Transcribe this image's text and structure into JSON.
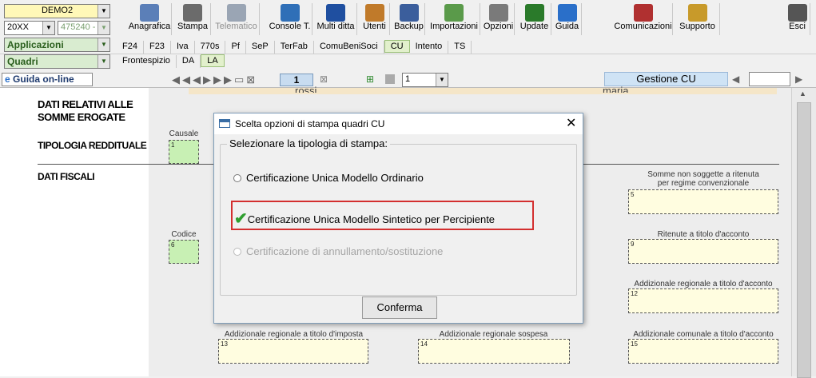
{
  "toolbar": {
    "company_combo": "DEMO2",
    "year_combo": "20XX",
    "code_combo": "475240 -",
    "applicazioni_combo": "Applicazioni",
    "quadri_combo": "Quadri",
    "buttons": [
      {
        "label": "Anagrafica",
        "icon": "address-book-icon",
        "color": "#5b7fb8"
      },
      {
        "label": "Stampa",
        "icon": "printer-icon",
        "color": "#6b6b6b"
      },
      {
        "label": "Telematico",
        "icon": "telematico-icon",
        "color": "#9aa5b4"
      },
      {
        "label": "Console T.",
        "icon": "console-icon",
        "color": "#2f6fb7"
      },
      {
        "label": "Multi ditta",
        "icon": "multi-ditta-icon",
        "color": "#1f4fa0"
      },
      {
        "label": "Utenti",
        "icon": "users-icon",
        "color": "#c07a2a"
      },
      {
        "label": "Backup",
        "icon": "backup-icon",
        "color": "#3b5e9c"
      },
      {
        "label": "Importazioni",
        "icon": "import-icon",
        "color": "#5a9a4a"
      },
      {
        "label": "Opzioni",
        "icon": "wrench-icon",
        "color": "#7a7a7a"
      },
      {
        "label": "Update",
        "icon": "update-icon",
        "color": "#2a7a2a"
      },
      {
        "label": "Guida",
        "icon": "help-icon",
        "color": "#2a6fc9"
      },
      {
        "label": "Comunicazioni",
        "icon": "communications-icon",
        "color": "#b03030"
      },
      {
        "label": "Supporto",
        "icon": "support-icon",
        "color": "#c89a2a"
      },
      {
        "label": "Esci",
        "icon": "exit-icon",
        "color": "#555555"
      }
    ]
  },
  "tabs_row1": [
    "F24",
    "F23",
    "Iva",
    "770s",
    "Pf",
    "SeP",
    "TerFab",
    "ComuBeniSoci",
    "CU",
    "Intento",
    "TS"
  ],
  "tabs_row1_selected": "CU",
  "tabs_row2": [
    "Frontespizio",
    "DA",
    "LA"
  ],
  "tabs_row2_selected": "LA",
  "navbar": {
    "guida_online": "Guida on-line",
    "page_number": "1",
    "page_select": "1",
    "gestione": "Gestione CU"
  },
  "form": {
    "header_left": "rossi",
    "header_right": "maria",
    "section_dati_relativi": "DATI RELATIVI ALLE\nSOMME EROGATE",
    "section_tipologia": "TIPOLOGIA REDDITUALE",
    "section_dati_fiscali": "DATI FISCALI",
    "causale_label": "Causale",
    "causale_num": "1",
    "codice_label": "Codice",
    "codice_num": "6",
    "somme_non_soggette_label": "Somme non soggette a ritenuta\nper regime convenzionale",
    "somme_non_soggette_num": "5",
    "ritenute_acconto_label": "Ritenute a titolo d'acconto",
    "ritenute_acconto_num": "9",
    "add_reg_acconto_label": "Addizionale regionale a titolo d'acconto",
    "add_reg_acconto_num": "12",
    "add_reg_imposta_label": "Addizionale regionale a titolo d'imposta",
    "add_reg_imposta_num": "13",
    "add_reg_sospesa_label": "Addizionale regionale sospesa",
    "add_reg_sospesa_num": "14",
    "add_com_acconto_label": "Addizionale comunale a titolo d'acconto",
    "add_com_acconto_num": "15"
  },
  "dialog": {
    "title": "Scelta opzioni di stampa quadri CU",
    "group_label": "Selezionare la tipologia di stampa:",
    "option_ordinario": "Certificazione Unica Modello Ordinario",
    "option_sintetico": "Certificazione Unica Modello Sintetico per Percipiente",
    "option_annullamento": "Certificazione di annullamento/sostituzione",
    "selected_option": "sintetico",
    "confirm_button": "Conferma",
    "highlight_color": "#d32f2f",
    "check_color": "#2e9e2e"
  }
}
